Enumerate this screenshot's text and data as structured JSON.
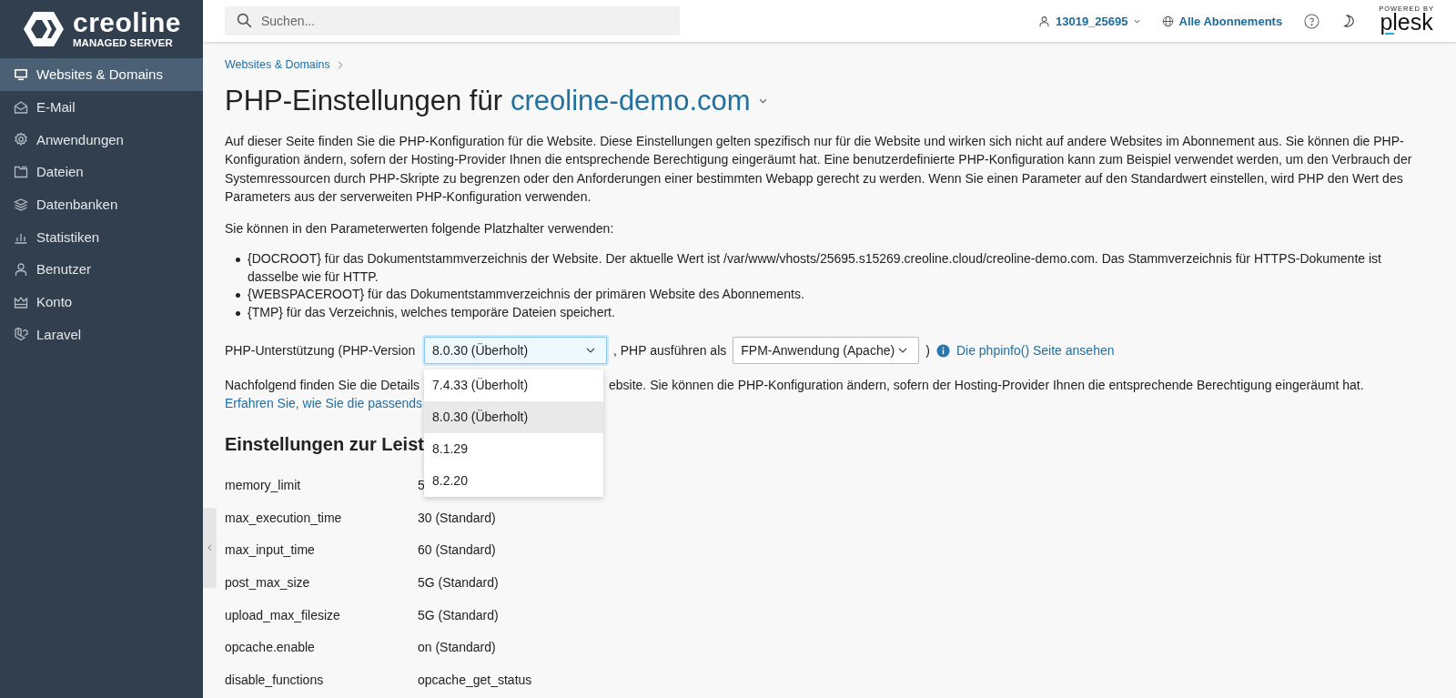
{
  "sidebar": {
    "logo": {
      "name": "creoline",
      "tagline": "MANAGED SERVER"
    },
    "items": [
      {
        "label": "Websites & Domains",
        "selected": true
      },
      {
        "label": "E-Mail",
        "selected": false
      },
      {
        "label": "Anwendungen",
        "selected": false
      },
      {
        "label": "Dateien",
        "selected": false
      },
      {
        "label": "Datenbanken",
        "selected": false
      },
      {
        "label": "Statistiken",
        "selected": false
      },
      {
        "label": "Benutzer",
        "selected": false
      },
      {
        "label": "Konto",
        "selected": false
      },
      {
        "label": "Laravel",
        "selected": false
      }
    ]
  },
  "topbar": {
    "search": {
      "placeholder": "Suchen..."
    },
    "account": "13019_25695",
    "subscriptions": "Alle Abonnements",
    "powered_by": "POWERED BY",
    "brand": "plesk"
  },
  "breadcrumb": [
    "Websites & Domains"
  ],
  "title": {
    "text": "PHP-Einstellungen für",
    "domain": "creoline-demo.com"
  },
  "intro": "Auf dieser Seite finden Sie die PHP-Konfiguration für die Website. Diese Einstellungen gelten spezifisch nur für die Website und wirken sich nicht auf andere Websites im Abonnement aus. Sie können die PHP-Konfiguration ändern, sofern der Hosting-Provider Ihnen die entsprechende Berechtigung eingeräumt hat. Eine benutzerdefinierte PHP-Konfiguration kann zum Beispiel verwendet werden, um den Verbrauch der Systemressourcen durch PHP-Skripte zu begrenzen oder den Anforderungen einer bestimmten Webapp gerecht zu werden. Wenn Sie einen Parameter auf den Standardwert einstellen, wird PHP den Wert des Parameters aus der serverweiten PHP-Konfiguration verwenden.",
  "placeholders_intro": "Sie können in den Parameterwerten folgende Platzhalter verwenden:",
  "placeholders": [
    "{DOCROOT} für das Dokumentstammverzeichnis der Website. Der aktuelle Wert ist /var/www/vhosts/25695.s15269.creoline.cloud/creoline-demo.com. Das Stammverzeichnis für HTTPS-Dokumente ist dasselbe wie für HTTP.",
    "{WEBSPACEROOT} für das Dokumentstammverzeichnis der primären Website des Abonnements.",
    "{TMP} für das Verzeichnis, welches temporäre Dateien speichert."
  ],
  "php_line": {
    "label": "PHP-Unterstützung (PHP-Version",
    "version": "8.0.30 (Überholt)",
    "run_as_label": ", PHP ausführen als",
    "handler": "FPM-Anwendung (Apache)",
    "close": ")",
    "phpinfo_link": "Die phpinfo() Seite ansehen"
  },
  "version_menu": [
    {
      "label": "7.4.33 (Überholt)",
      "selected": false
    },
    {
      "label": "8.0.30 (Überholt)",
      "selected": true
    },
    {
      "label": "8.1.29",
      "selected": false
    },
    {
      "label": "8.2.20",
      "selected": false
    }
  ],
  "details": {
    "text_start": "Nachfolgend finden Sie die Details",
    "text_end": "ebsite. Sie können die PHP-Konfiguration ändern, sofern der Hosting-Provider Ihnen die entsprechende Berechtigung eingeräumt hat.",
    "link": "Erfahren Sie, wie Sie die passends"
  },
  "section_heading": "Einstellungen zur Leist",
  "settings": [
    {
      "name": "memory_limit",
      "value": "5"
    },
    {
      "name": "max_execution_time",
      "value": "30 (Standard)"
    },
    {
      "name": "max_input_time",
      "value": "60 (Standard)"
    },
    {
      "name": "post_max_size",
      "value": "5G (Standard)"
    },
    {
      "name": "upload_max_filesize",
      "value": "5G (Standard)"
    },
    {
      "name": "opcache.enable",
      "value": "on (Standard)"
    },
    {
      "name": "disable_functions",
      "value": "opcache_get_status"
    }
  ]
}
